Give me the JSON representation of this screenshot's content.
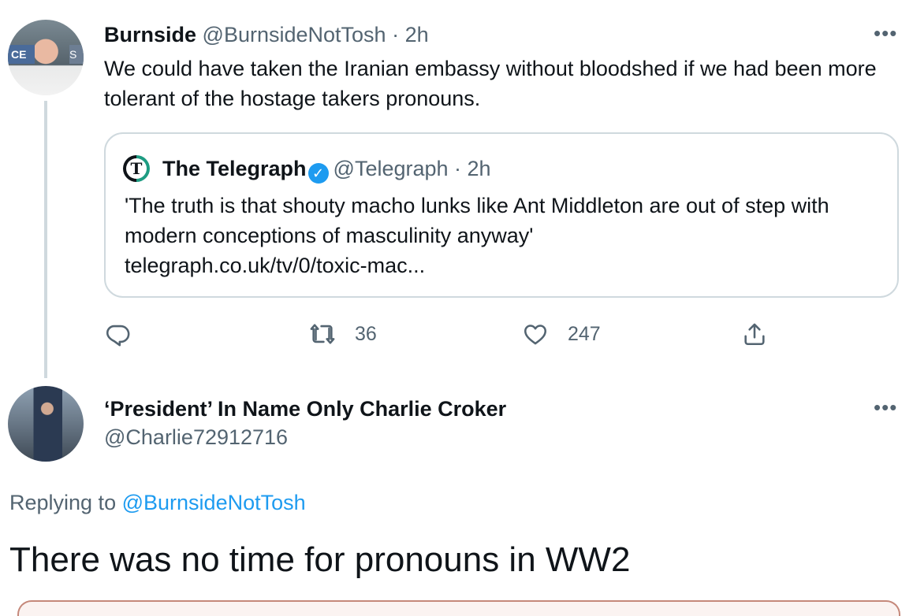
{
  "tweet1": {
    "name": "Burnside",
    "handle": "@BurnsideNotTosh",
    "time": "2h",
    "text": "We could have taken the Iranian embassy without bloodshed if we had been more tolerant of the hostage takers pronouns.",
    "avatar_banner_left": "CE",
    "avatar_banner_right": "S",
    "quote": {
      "logo_letter": "T",
      "name": "The Telegraph",
      "verified_icon": "verified-badge-icon",
      "handle": "@Telegraph",
      "time": "2h",
      "text": "'The truth is that shouty macho lunks like Ant Middleton are out of step with modern conceptions of masculinity anyway'",
      "link": "telegraph.co.uk/tv/0/toxic-mac..."
    },
    "actions": {
      "reply_icon": "reply-icon",
      "retweet_icon": "retweet-icon",
      "retweet_count": "36",
      "like_icon": "heart-icon",
      "like_count": "247",
      "share_icon": "share-icon"
    }
  },
  "tweet2": {
    "name": "‘President’ In Name Only Charlie Croker",
    "handle": "@Charlie72912716",
    "replying_prefix": "Replying to",
    "replying_to": "@BurnsideNotTosh",
    "text": "There was no time for pronouns in WW2"
  },
  "more_label": "•••",
  "colors": {
    "link": "#1d9bf0",
    "muted": "#536471",
    "text": "#0f1419",
    "border": "#cfd9de"
  }
}
